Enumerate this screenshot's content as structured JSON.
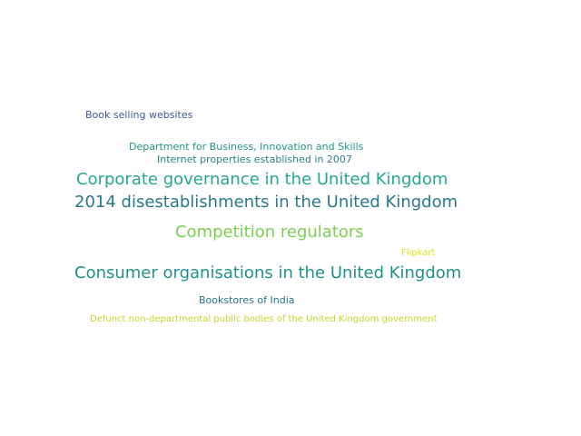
{
  "words": [
    {
      "text": "Book selling websites",
      "color": "#3b5b92"
    },
    {
      "text": "Department for Business, Innovation and Skills",
      "color": "#23938a"
    },
    {
      "text": "Internet properties established in 2007",
      "color": "#2a7f8e"
    },
    {
      "text": "Corporate governance in the United Kingdom",
      "color": "#25a88a"
    },
    {
      "text": "2014 disestablishments in the United Kingdom",
      "color": "#2a788e"
    },
    {
      "text": "Competition regulators",
      "color": "#7ad151"
    },
    {
      "text": "Flipkart",
      "color": "#dfe318"
    },
    {
      "text": "Consumer organisations in the United Kingdom",
      "color": "#21918c"
    },
    {
      "text": "Bookstores of India",
      "color": "#2c728e"
    },
    {
      "text": "Defunct non-departmental public bodies of the United Kingdom government",
      "color": "#b5de2b"
    }
  ]
}
